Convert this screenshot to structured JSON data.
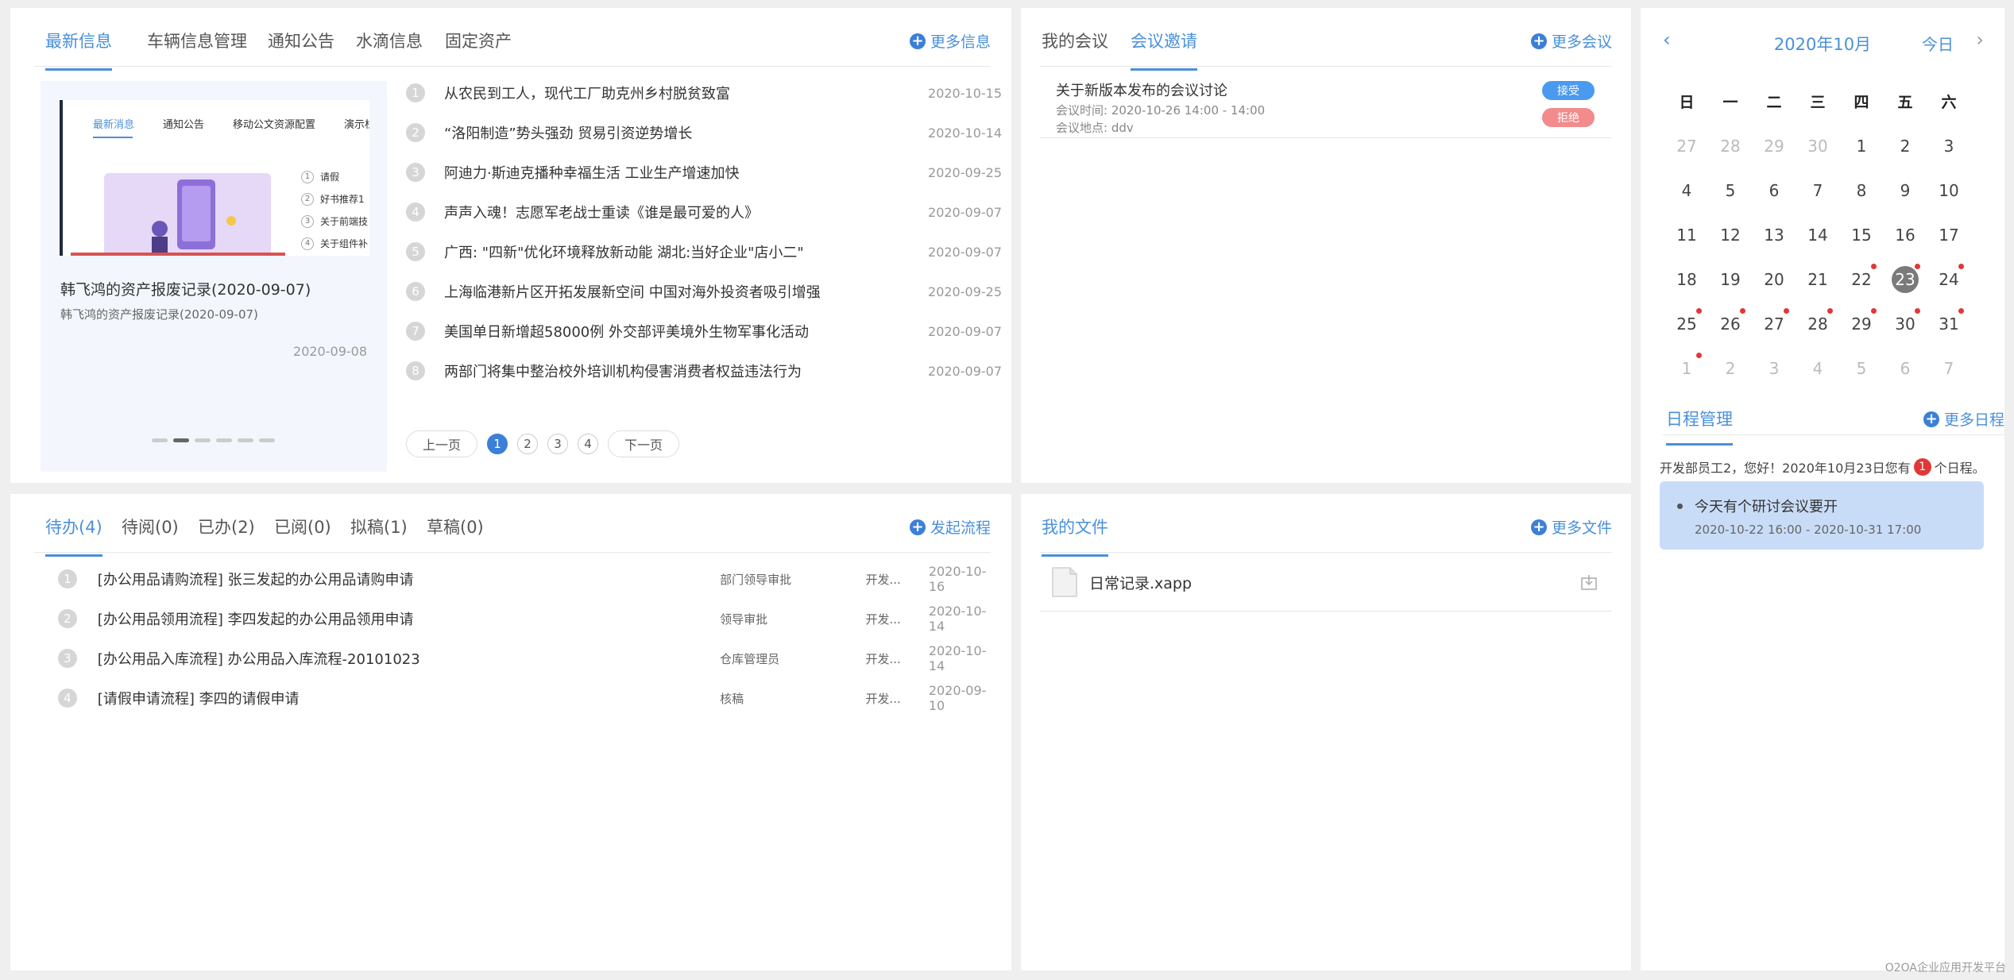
{
  "news": {
    "tabs": [
      "最新信息",
      "车辆信息管理",
      "通知公告",
      "水滴信息",
      "固定资产"
    ],
    "more_label": "更多信息",
    "slide": {
      "caption_title": "韩飞鸿的资产报废记录(2020-09-07)",
      "caption_sub": "韩飞鸿的资产报废记录(2020-09-07)",
      "date": "2020-09-08",
      "thumb_tabs": [
        "最新消息",
        "通知公告",
        "移动公文资源配置",
        "演示栏目"
      ],
      "thumb_list": [
        "请假",
        "好书推荐1",
        "关于前端技",
        "关于组件补"
      ]
    },
    "items": [
      {
        "n": "1",
        "title": "从农民到工人，现代工厂助克州乡村脱贫致富",
        "date": "2020-10-15"
      },
      {
        "n": "2",
        "title": "“洛阳制造”势头强劲 贸易引资逆势增长",
        "date": "2020-10-14"
      },
      {
        "n": "3",
        "title": "阿迪力·斯迪克播种幸福生活 工业生产增速加快",
        "date": "2020-09-25"
      },
      {
        "n": "4",
        "title": "声声入魂！志愿军老战士重读《谁是最可爱的人》",
        "date": "2020-09-07"
      },
      {
        "n": "5",
        "title": "广西: \"四新\"优化环境释放新动能 湖北:当好企业\"店小二\"",
        "date": "2020-09-07"
      },
      {
        "n": "6",
        "title": "上海临港新片区开拓发展新空间 中国对海外投资者吸引增强",
        "date": "2020-09-25"
      },
      {
        "n": "7",
        "title": "美国单日新增超58000例 外交部评美境外生物军事化活动",
        "date": "2020-09-07"
      },
      {
        "n": "8",
        "title": "两部门将集中整治校外培训机构侵害消费者权益违法行为",
        "date": "2020-09-07"
      }
    ],
    "pager": {
      "prev": "上一页",
      "next": "下一页",
      "pages": [
        "1",
        "2",
        "3",
        "4"
      ]
    }
  },
  "meeting": {
    "tabs": [
      "我的会议",
      "会议邀请"
    ],
    "more_label": "更多会议",
    "item": {
      "title": "关于新版本发布的会议讨论",
      "time": "会议时间: 2020-10-26 14:00 - 14:00",
      "place": "会议地点: ddv",
      "accept": "接受",
      "reject": "拒绝"
    }
  },
  "calendar": {
    "month_title": "2020年10月",
    "today_label": "今日",
    "weekdays": [
      "日",
      "一",
      "二",
      "三",
      "四",
      "五",
      "六"
    ],
    "weeks": [
      [
        "27",
        "28",
        "29",
        "30",
        "1",
        "2",
        "3"
      ],
      [
        "4",
        "5",
        "6",
        "7",
        "8",
        "9",
        "10"
      ],
      [
        "11",
        "12",
        "13",
        "14",
        "15",
        "16",
        "17"
      ],
      [
        "18",
        "19",
        "20",
        "21",
        "22",
        "23",
        "24"
      ],
      [
        "25",
        "26",
        "27",
        "28",
        "29",
        "30",
        "31"
      ],
      [
        "1",
        "2",
        "3",
        "4",
        "5",
        "6",
        "7"
      ]
    ],
    "schedule_tab": "日程管理",
    "schedule_more": "更多日程",
    "greeting_pre": "开发部员工2，您好！2020年10月23日您有",
    "greeting_count": "1",
    "greeting_post": "个日程。",
    "event_title": "今天有个研讨会议要开",
    "event_time": "2020-10-22 16:00 - 2020-10-31 17:00"
  },
  "todo": {
    "tabs": [
      "待办(4)",
      "待阅(0)",
      "已办(2)",
      "已阅(0)",
      "拟稿(1)",
      "草稿(0)"
    ],
    "more_label": "发起流程",
    "items": [
      {
        "n": "1",
        "title": "[办公用品请购流程] 张三发起的办公用品请购申请",
        "step": "部门领导审批",
        "person": "开发...",
        "date": "2020-10-16"
      },
      {
        "n": "2",
        "title": "[办公用品领用流程] 李四发起的办公用品领用申请",
        "step": "领导审批",
        "person": "开发...",
        "date": "2020-10-14"
      },
      {
        "n": "3",
        "title": "[办公用品入库流程] 办公用品入库流程-20101023",
        "step": "仓库管理员",
        "person": "开发...",
        "date": "2020-10-14"
      },
      {
        "n": "4",
        "title": "[请假申请流程] 李四的请假申请",
        "step": "核稿",
        "person": "开发...",
        "date": "2020-09-10"
      }
    ]
  },
  "files": {
    "tabs": [
      "我的文件"
    ],
    "more_label": "更多文件",
    "items": [
      {
        "name": "日常记录.xapp"
      }
    ]
  },
  "footer": "O2OA企业应用开发平台"
}
